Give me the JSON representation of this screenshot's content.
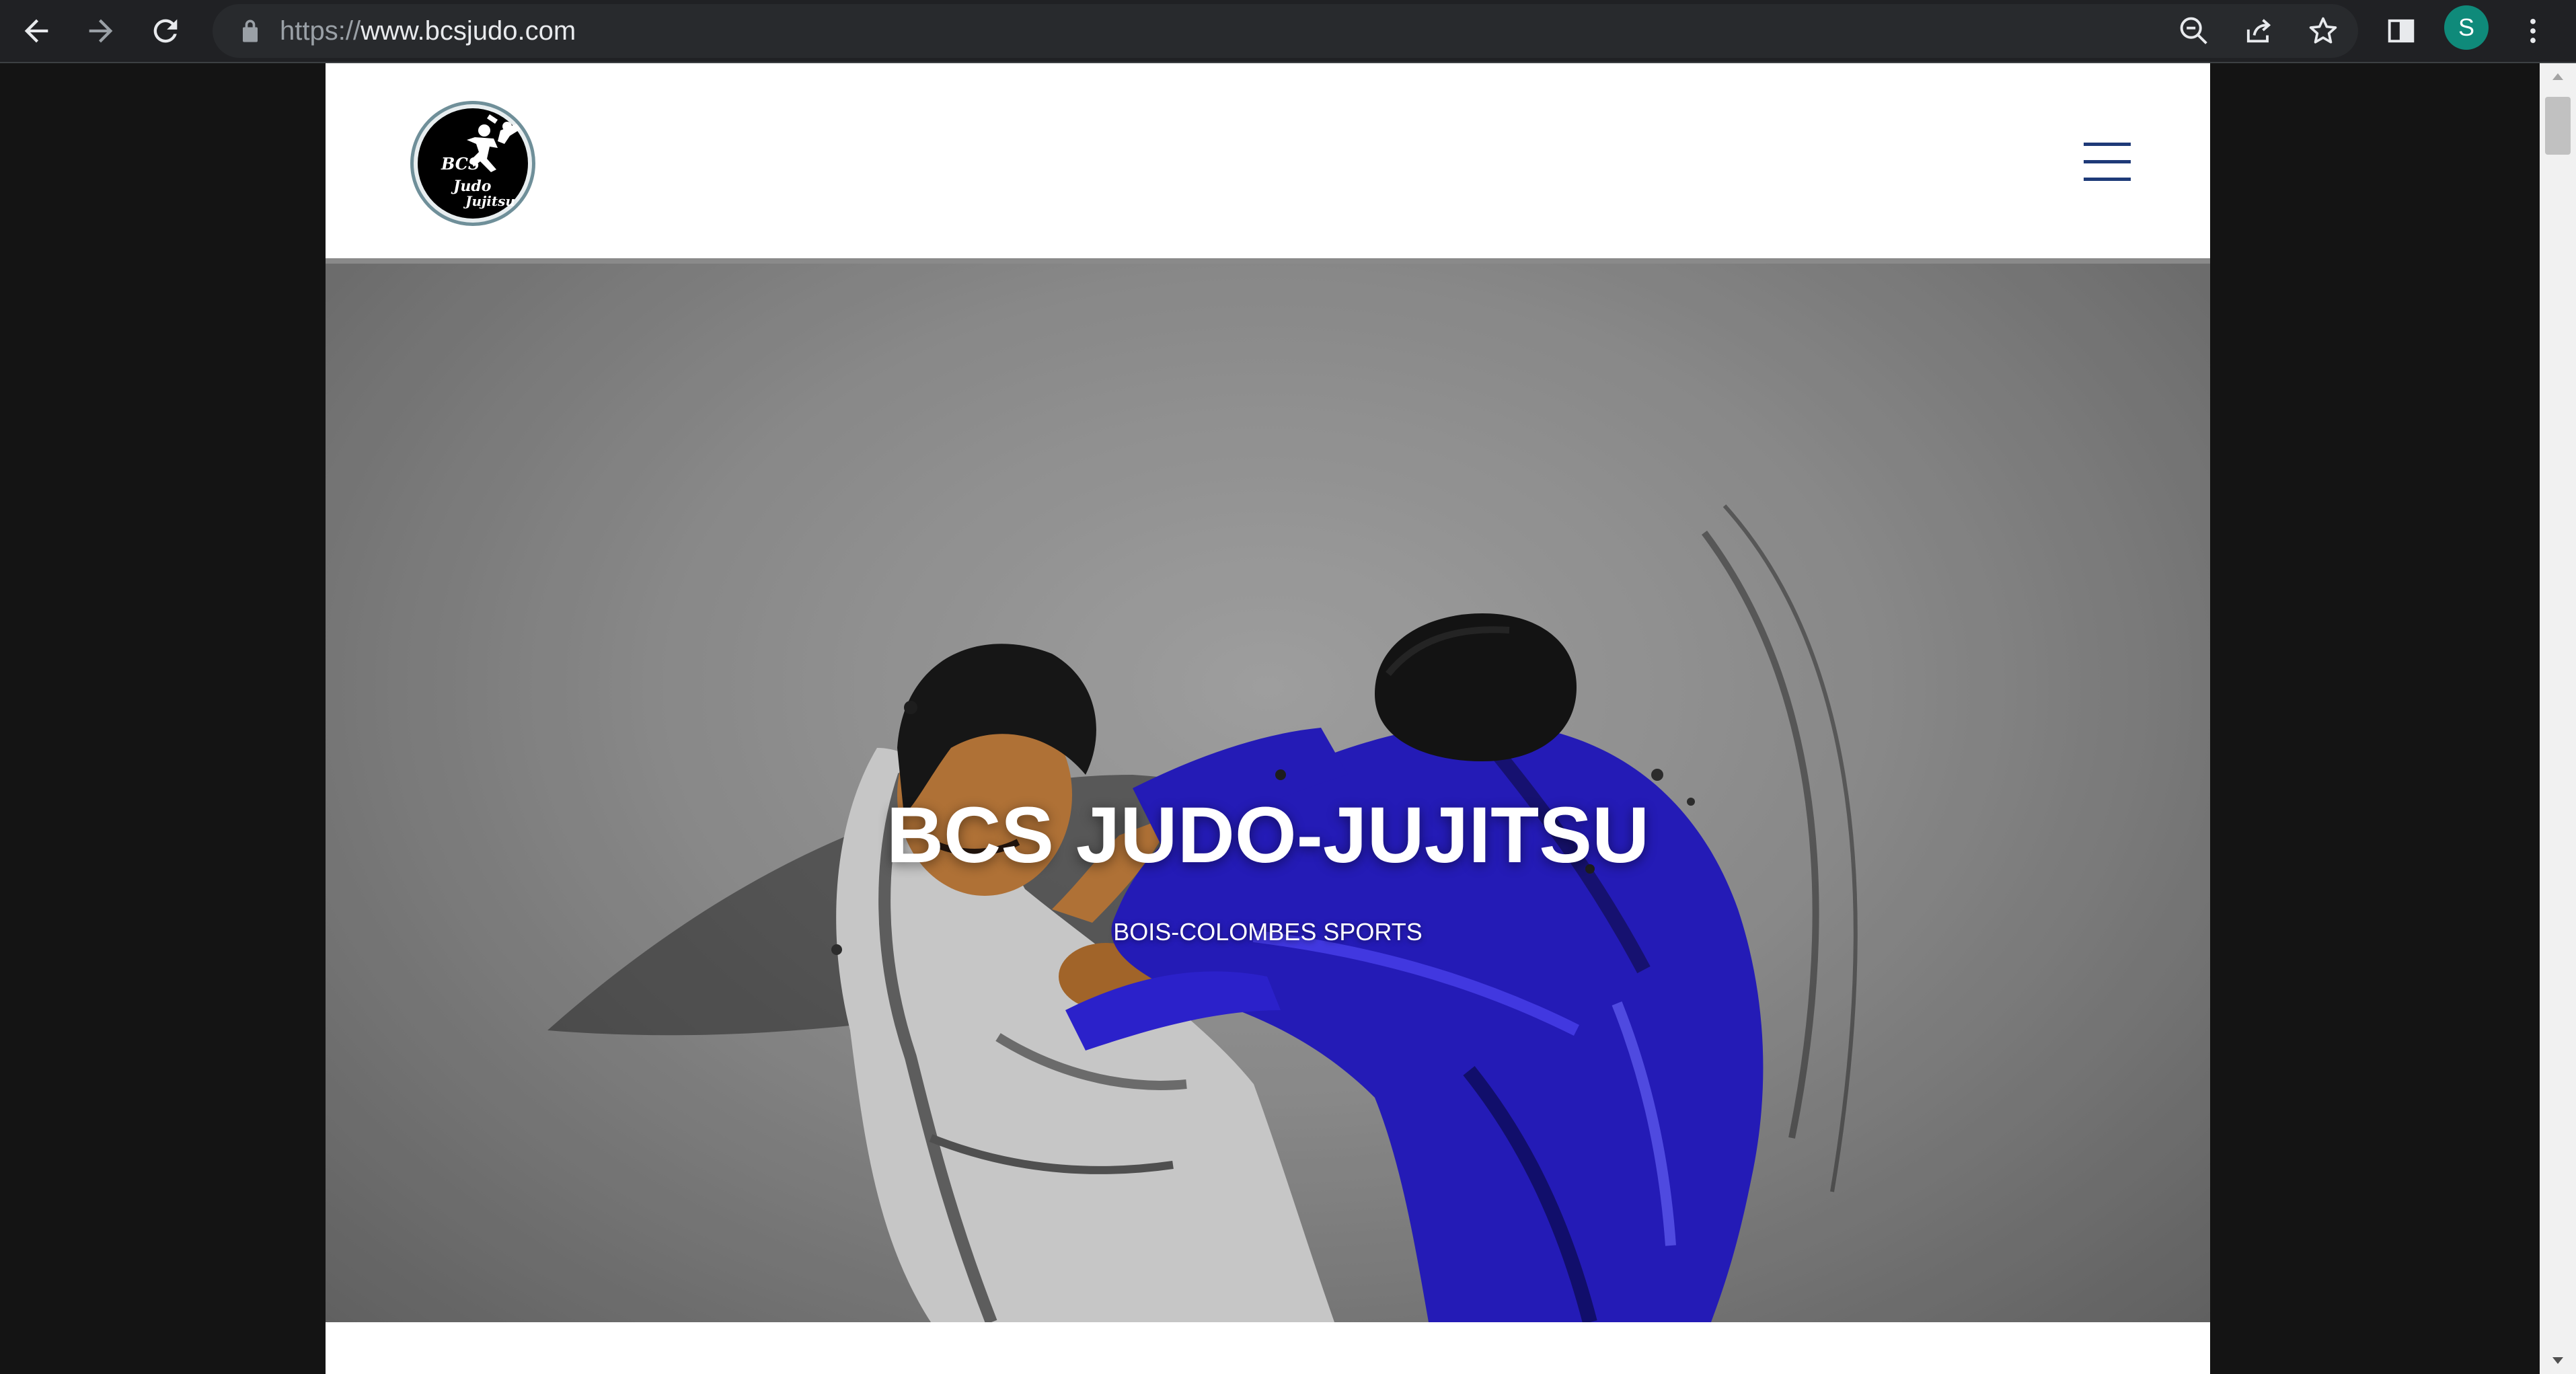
{
  "browser": {
    "url_scheme": "https://",
    "url_host": "www.bcsjudo.com",
    "profile_initial": "S",
    "icons": {
      "back": "arrow-left-icon",
      "forward": "arrow-right-icon",
      "reload": "reload-icon",
      "lock": "lock-icon",
      "zoom": "zoom-out-icon",
      "share": "share-icon",
      "bookmark": "star-icon",
      "side_panel": "side-panel-icon",
      "menu": "kebab-menu-icon"
    }
  },
  "site": {
    "logo": {
      "line1": "BCS",
      "line2": "Judo",
      "line3": "Jujitsu"
    },
    "menu_icon": "hamburger-icon",
    "hero": {
      "title": "BCS JUDO-JUJITSU",
      "subtitle": "BOIS-COLOMBES SPORTS"
    }
  },
  "colors": {
    "chrome_bg": "#202124",
    "omnibox_bg": "#282a2d",
    "avatar_bg": "#0f8a7a",
    "hamburger": "#1e3a78",
    "gi_blue": "#2a1fd0"
  }
}
